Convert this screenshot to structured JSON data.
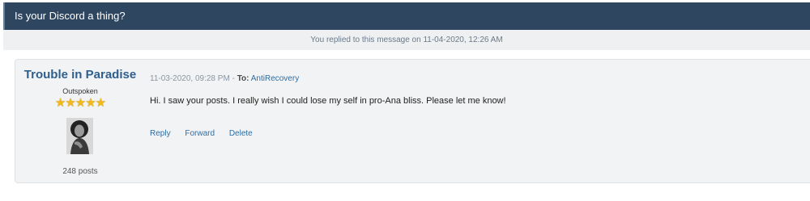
{
  "thread": {
    "title": "Is your Discord a thing?"
  },
  "notice": {
    "text": "You replied to this message on 11-04-2020, 12:26 AM"
  },
  "post": {
    "author": {
      "name": "Trouble in Paradise",
      "rank": "Outspoken",
      "stars": "★★★★★",
      "rating": 5,
      "post_count": "248 posts"
    },
    "date": "11-03-2020, 09:28 PM",
    "separator": "-",
    "to_label": "To:",
    "recipient": "AntiRecovery",
    "message": "Hi. I saw your posts. I really wish I could lose my self in pro-Ana bliss. Please let me know!",
    "actions": [
      "Reply",
      "Forward",
      "Delete"
    ]
  }
}
